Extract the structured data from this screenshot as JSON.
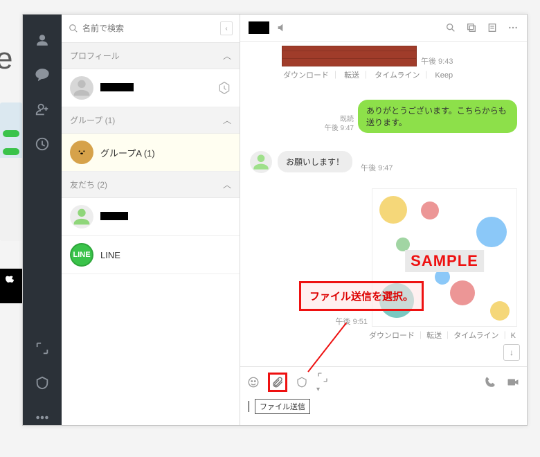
{
  "window_controls": {
    "min": "—",
    "max": "☐",
    "close": "✕"
  },
  "search": {
    "placeholder": "名前で検索"
  },
  "sections": {
    "profile": "プロフィール",
    "groups_label": "グループ",
    "groups_count": "(1)",
    "friends_label": "友だち",
    "friends_count": "(2)"
  },
  "contacts": {
    "group_a_name": "グループA",
    "group_a_count": "(1)",
    "line_name": "LINE",
    "line_badge": "LINE"
  },
  "chat": {
    "brick_time": "午後 9:43",
    "actions": {
      "download": "ダウンロード",
      "forward": "転送",
      "timeline": "タイムライン",
      "keep": "Keep",
      "sep": "｜"
    },
    "read_label": "既読",
    "out_time": "午後 9:47",
    "out_text": "ありがとうございます。こちらからも送ります。",
    "in_text": "お願いします！",
    "in_time": "午後 9:47",
    "img_label": "SAMPLE",
    "img_time": "午後 9:51"
  },
  "tooltip": "ファイル送信",
  "callout": "ファイル送信を選択。"
}
